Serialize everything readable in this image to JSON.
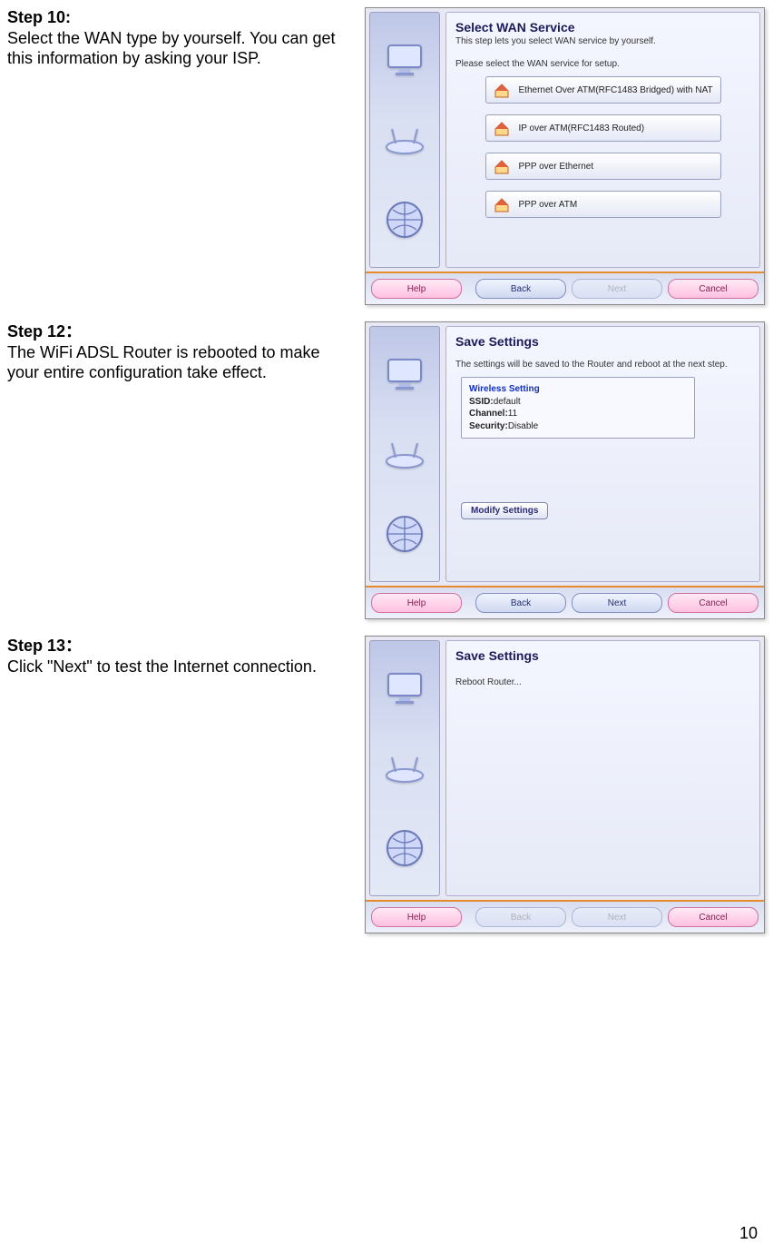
{
  "page_number": "10",
  "step10": {
    "label": "Step 10:",
    "desc": "Select the WAN type by yourself. You can get this information by asking your ISP.",
    "wizard": {
      "title": "Select WAN Service",
      "subtitle": "This step lets you select WAN service by yourself.",
      "note": "Please select the WAN service for setup.",
      "options": [
        "Ethernet Over ATM(RFC1483 Bridged) with NAT",
        "IP over ATM(RFC1483 Routed)",
        "PPP over Ethernet",
        "PPP over ATM"
      ],
      "buttons": {
        "help": "Help",
        "back": "Back",
        "next": "Next",
        "cancel": "Cancel"
      },
      "next_enabled": false
    }
  },
  "step12": {
    "label": "Step 12：",
    "desc": "The WiFi ADSL Router is rebooted to make your entire configuration take effect.",
    "wizard": {
      "title": "Save Settings",
      "subtitle": "The settings will be saved to the Router and reboot at the next step.",
      "settings_header": "Wireless Setting",
      "settings": [
        {
          "k": "SSID",
          "v": "default"
        },
        {
          "k": "Channel",
          "v": "11"
        },
        {
          "k": "Security",
          "v": "Disable"
        }
      ],
      "modify_label": "Modify Settings",
      "buttons": {
        "help": "Help",
        "back": "Back",
        "next": "Next",
        "cancel": "Cancel"
      },
      "next_enabled": true
    }
  },
  "step13": {
    "label": "Step 13：",
    "desc": "Click \"Next\" to test the Internet connection.",
    "wizard": {
      "title": "Save Settings",
      "subtitle": "Reboot Router...",
      "buttons": {
        "help": "Help",
        "back": "Back",
        "next": "Next",
        "cancel": "Cancel"
      },
      "next_enabled": false,
      "back_enabled": false
    }
  }
}
